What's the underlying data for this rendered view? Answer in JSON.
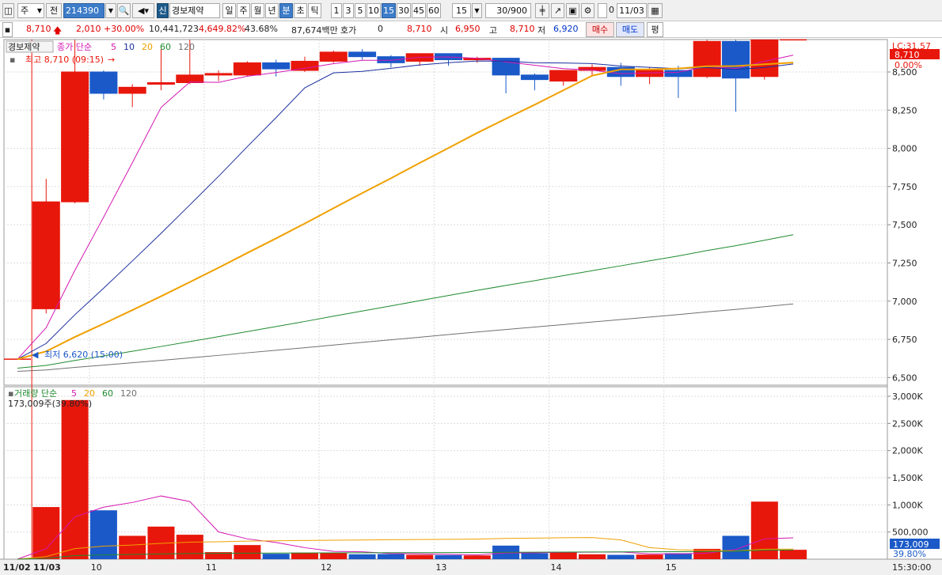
{
  "toolbar": {
    "market": "주",
    "prev_label": "전",
    "code": "214390",
    "badge": "신",
    "stock_name": "경보제약",
    "periods": [
      "일",
      "주",
      "월",
      "년",
      "분",
      "초",
      "틱"
    ],
    "active_period": "분",
    "intervals": [
      "1",
      "3",
      "5",
      "10",
      "15",
      "30",
      "45",
      "60"
    ],
    "active_interval": "15",
    "interval_select": "15",
    "count": "30/900",
    "checkbox_label": "0",
    "date": "11/03"
  },
  "info": {
    "price": "8,710",
    "change": "2,010",
    "change_pct": "+30.00%",
    "volume": "10,441,723",
    "volume_pct": "4,649.82%",
    "turnover": "43.68%",
    "amount": "87,674백만",
    "hoga_label": "호가",
    "hoga_value": "0",
    "hoga_price": "8,710",
    "open_label": "시",
    "open": "6,950",
    "high_label": "고",
    "high": "8,710",
    "low_label": "저",
    "low": "6,920",
    "buy_button": "매수",
    "sell_button": "매도",
    "avg_button": "평"
  },
  "price_panel": {
    "stock_tag": "경보제약",
    "legend_prefix": "종가 단순",
    "legend_periods": [
      "5",
      "10",
      "20",
      "60",
      "120"
    ],
    "legend_colors": [
      "#d418b4",
      "#1a2f9e",
      "#f0a000",
      "#1f8a2e",
      "#707070"
    ],
    "high_note": "최고 8,710 (09:15)",
    "low_note": "최저 6,620 (15:00)",
    "lc_label": "LC:31.57",
    "current_price_tag": "8,710",
    "current_pct": "0.00%",
    "y_ticks": [
      "8,500",
      "8,250",
      "8,000",
      "7,750",
      "7,500",
      "7,250",
      "7,000",
      "6,750",
      "6,500"
    ]
  },
  "volume_panel": {
    "legend_label": "거래량 단순",
    "legend_periods": [
      "5",
      "20",
      "60",
      "120"
    ],
    "legend_colors": [
      "#d418b4",
      "#f0a000",
      "#1f8a2e",
      "#707070"
    ],
    "current_volume": "173,009주(39.80%)",
    "current_tag": "173,009",
    "current_pct": "39.80%",
    "y_ticks": [
      "3,000K",
      "2,500K",
      "2,000K",
      "1,500K",
      "1,000K",
      "500,000"
    ]
  },
  "x_axis": {
    "labels": [
      "11/02",
      "11/03",
      "10",
      "11",
      "12",
      "13",
      "14",
      "15"
    ],
    "end_time": "15:30:00"
  },
  "colors": {
    "up": "#e8170b",
    "down": "#1b59c8",
    "background": "#ffffff"
  },
  "chart_data": {
    "type": "candlestick",
    "interval": "15분",
    "price_axis": {
      "min": 6450,
      "max": 8650
    },
    "volume_axis": {
      "min": 0,
      "max": 3000000
    },
    "candles": [
      {
        "o": 6650,
        "h": 6650,
        "l": 6620,
        "c": 6620,
        "v": 0
      },
      {
        "o": 6950,
        "h": 7800,
        "l": 6920,
        "c": 7650,
        "v": 960000
      },
      {
        "o": 7650,
        "h": 8710,
        "l": 7640,
        "c": 8500,
        "v": 2930000
      },
      {
        "o": 8500,
        "h": 8510,
        "l": 8320,
        "c": 8360,
        "v": 900000
      },
      {
        "o": 8360,
        "h": 8420,
        "l": 8270,
        "c": 8400,
        "v": 430000
      },
      {
        "o": 8420,
        "h": 8650,
        "l": 8380,
        "c": 8430,
        "v": 600000
      },
      {
        "o": 8430,
        "h": 8710,
        "l": 8420,
        "c": 8480,
        "v": 450000
      },
      {
        "o": 8480,
        "h": 8510,
        "l": 8440,
        "c": 8490,
        "v": 130000
      },
      {
        "o": 8480,
        "h": 8570,
        "l": 8470,
        "c": 8560,
        "v": 260000
      },
      {
        "o": 8560,
        "h": 8580,
        "l": 8470,
        "c": 8520,
        "v": 100000
      },
      {
        "o": 8510,
        "h": 8600,
        "l": 8500,
        "c": 8570,
        "v": 120000
      },
      {
        "o": 8570,
        "h": 8640,
        "l": 8560,
        "c": 8630,
        "v": 110000
      },
      {
        "o": 8630,
        "h": 8650,
        "l": 8580,
        "c": 8600,
        "v": 90000
      },
      {
        "o": 8600,
        "h": 8610,
        "l": 8530,
        "c": 8560,
        "v": 95000
      },
      {
        "o": 8570,
        "h": 8620,
        "l": 8540,
        "c": 8620,
        "v": 80000
      },
      {
        "o": 8620,
        "h": 8620,
        "l": 8540,
        "c": 8580,
        "v": 75000
      },
      {
        "o": 8580,
        "h": 8600,
        "l": 8560,
        "c": 8590,
        "v": 70000
      },
      {
        "o": 8590,
        "h": 8590,
        "l": 8360,
        "c": 8480,
        "v": 250000
      },
      {
        "o": 8480,
        "h": 8490,
        "l": 8380,
        "c": 8450,
        "v": 110000
      },
      {
        "o": 8440,
        "h": 8510,
        "l": 8410,
        "c": 8510,
        "v": 130000
      },
      {
        "o": 8510,
        "h": 8550,
        "l": 8480,
        "c": 8530,
        "v": 90000
      },
      {
        "o": 8530,
        "h": 8560,
        "l": 8410,
        "c": 8470,
        "v": 80000
      },
      {
        "o": 8470,
        "h": 8530,
        "l": 8420,
        "c": 8510,
        "v": 85000
      },
      {
        "o": 8510,
        "h": 8540,
        "l": 8330,
        "c": 8470,
        "v": 110000
      },
      {
        "o": 8470,
        "h": 8710,
        "l": 8460,
        "c": 8700,
        "v": 190000
      },
      {
        "o": 8700,
        "h": 8710,
        "l": 8240,
        "c": 8460,
        "v": 430000
      },
      {
        "o": 8470,
        "h": 8710,
        "l": 8450,
        "c": 8710,
        "v": 1060000
      },
      {
        "o": 8710,
        "h": 8710,
        "l": 8710,
        "c": 8710,
        "v": 173009
      }
    ],
    "x_labels": [
      "11/02",
      "11/03",
      "10",
      "11",
      "12",
      "13",
      "14",
      "15"
    ]
  }
}
